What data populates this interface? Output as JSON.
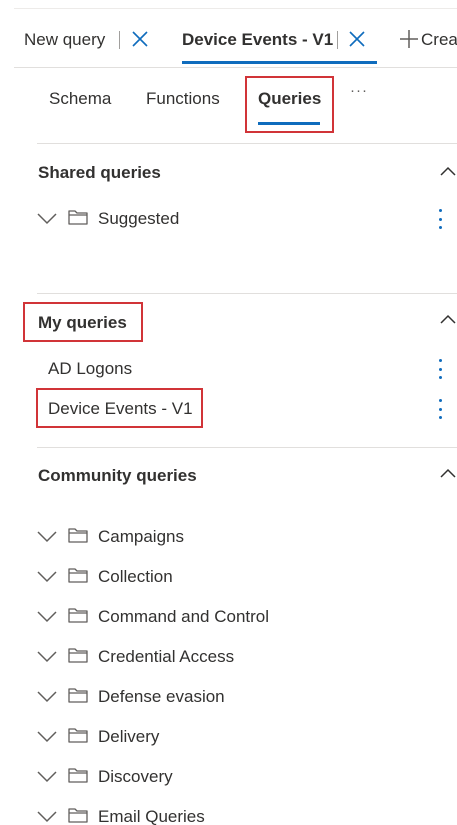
{
  "tabs": [
    {
      "label": "New query"
    },
    {
      "label": "Device Events - V1"
    }
  ],
  "create_label": "Crea",
  "subtabs": [
    {
      "label": "Schema"
    },
    {
      "label": "Functions"
    },
    {
      "label": "Queries"
    }
  ],
  "more_label": "···",
  "shared": {
    "title": "Shared queries",
    "folders": [
      {
        "label": "Suggested"
      }
    ]
  },
  "my": {
    "title": "My queries",
    "items": [
      {
        "label": "AD Logons"
      },
      {
        "label": "Device Events - V1"
      }
    ]
  },
  "community": {
    "title": "Community queries",
    "folders": [
      {
        "label": "Campaigns"
      },
      {
        "label": "Collection"
      },
      {
        "label": "Command and Control"
      },
      {
        "label": "Credential Access"
      },
      {
        "label": "Defense evasion"
      },
      {
        "label": "Delivery"
      },
      {
        "label": "Discovery"
      },
      {
        "label": "Email Queries"
      }
    ]
  },
  "colors": {
    "accent": "#0f6cbd",
    "highlight": "#d13438"
  }
}
